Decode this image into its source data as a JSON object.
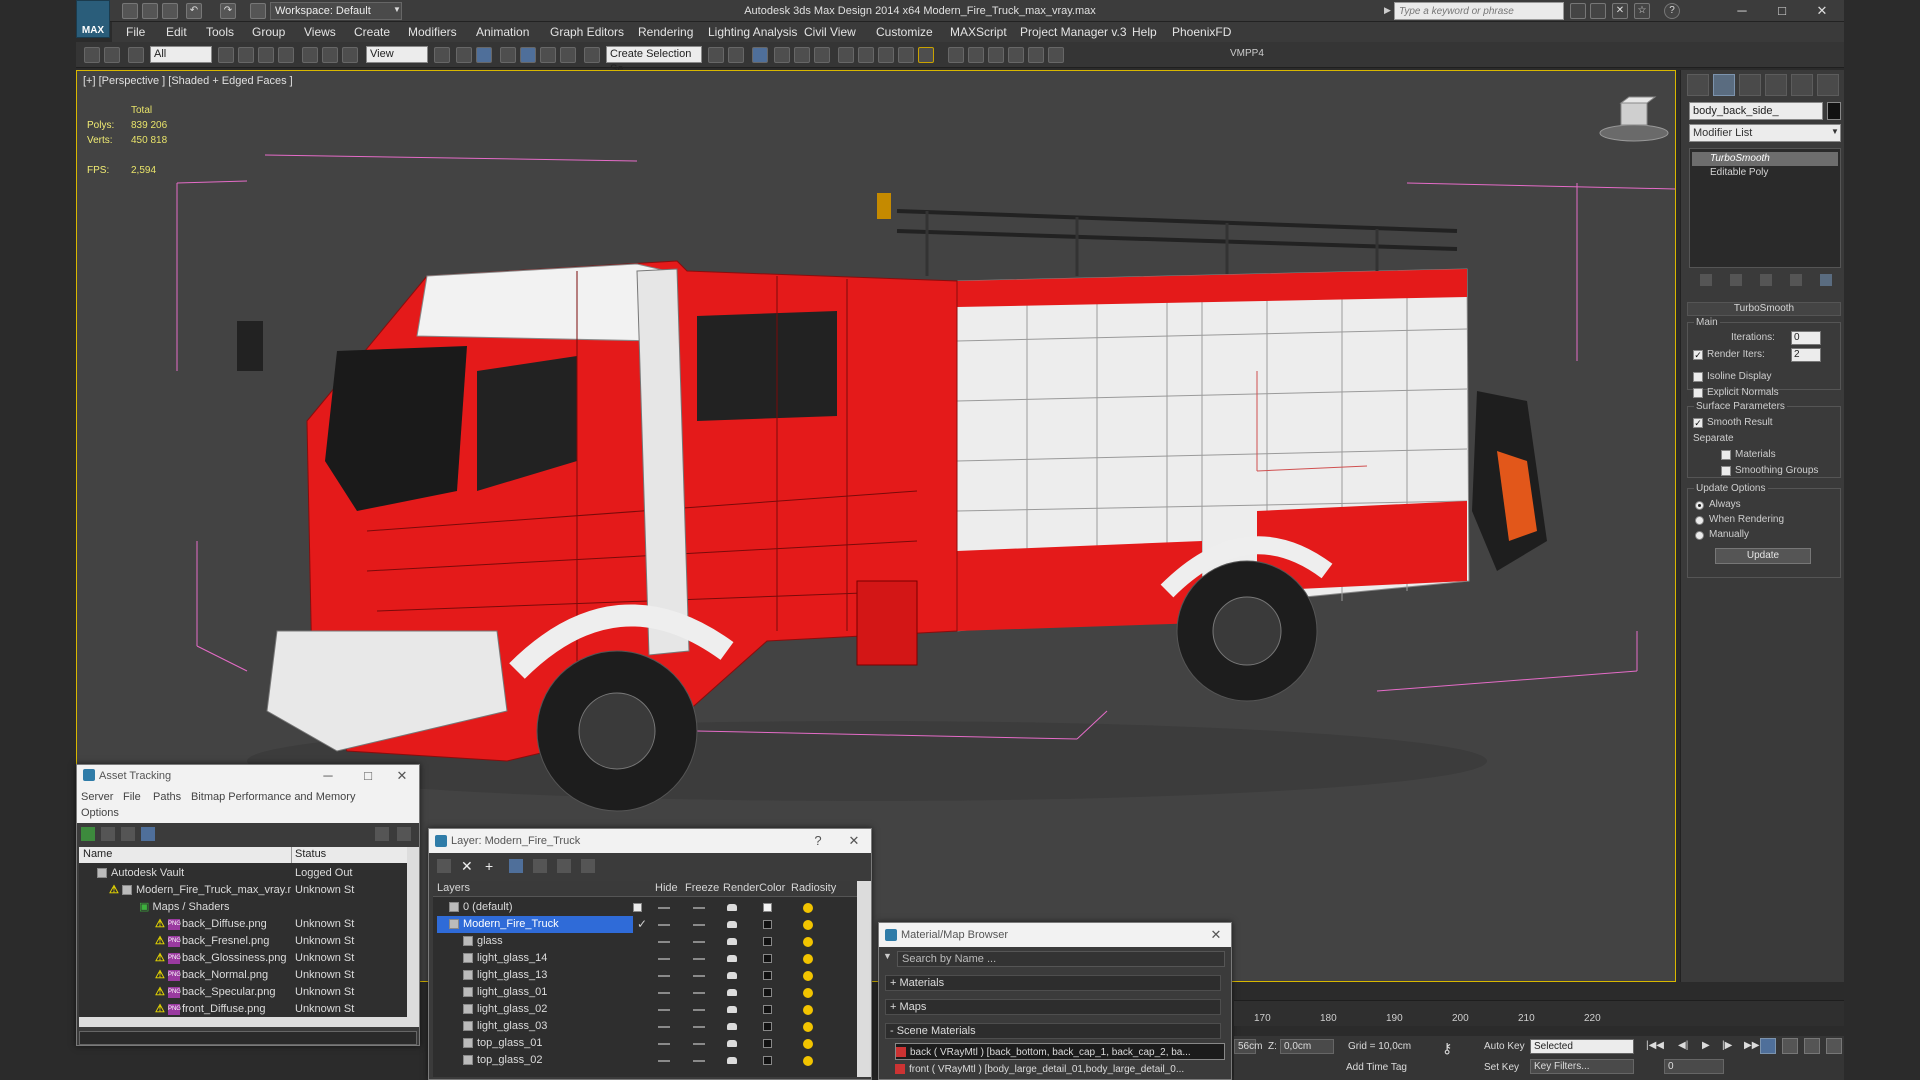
{
  "app": {
    "logo_text": "MAX",
    "workspace_label": "Workspace: Default",
    "window_title": "Autodesk 3ds Max Design 2014 x64     Modern_Fire_Truck_max_vray.max",
    "search_placeholder": "Type a keyword or phrase",
    "win_minimize": "─",
    "win_maximize": "□",
    "win_close": "✕"
  },
  "menu": [
    "File",
    "Edit",
    "Tools",
    "Group",
    "Views",
    "Create",
    "Modifiers",
    "Animation",
    "Graph Editors",
    "Rendering",
    "Lighting Analysis",
    "Civil View",
    "Customize",
    "MAXScript",
    "Project Manager v.3",
    "Help",
    "PhoenixFD"
  ],
  "toolbar": {
    "selection_filter": "All",
    "reference_coord": "View",
    "named_selection": "Create Selection Se",
    "plugin_label": "VMPP4"
  },
  "viewport": {
    "label": "[+] [Perspective ] [Shaded + Edged Faces ]",
    "stats_total_label": "Total",
    "polys_label": "Polys:",
    "polys_value": "839 206",
    "verts_label": "Verts:",
    "verts_value": "450 818",
    "fps_label": "FPS:",
    "fps_value": "2,594"
  },
  "command_panel": {
    "object_name": "body_back_side_",
    "modifier_list": "Modifier List",
    "stack": [
      "TurboSmooth",
      "Editable Poly"
    ],
    "rollout_title": "TurboSmooth",
    "main_group": "Main",
    "iterations_label": "Iterations:",
    "iterations_value": "0",
    "render_iters_label": "Render Iters:",
    "render_iters_value": "2",
    "render_iters_checked": "✓",
    "isoline_display": "Isoline Display",
    "explicit_normals": "Explicit Normals",
    "surface_params_group": "Surface Parameters",
    "smooth_result": "Smooth Result",
    "smooth_result_checked": "✓",
    "separate_label": "Separate",
    "materials": "Materials",
    "smoothing_groups": "Smoothing Groups",
    "update_options_group": "Update Options",
    "always": "Always",
    "when_rendering": "When Rendering",
    "manually": "Manually",
    "update_button": "Update"
  },
  "asset_tracking": {
    "title": "Asset Tracking",
    "menu": [
      "Server",
      "File",
      "Paths",
      "Bitmap Performance and Memory",
      "Options"
    ],
    "col_name": "Name",
    "col_status": "Status",
    "rows": [
      {
        "name": "Autodesk Vault",
        "status": "Logged Out"
      },
      {
        "name": "Modern_Fire_Truck_max_vray.max",
        "status": "Unknown St"
      },
      {
        "name": "Maps / Shaders",
        "status": ""
      },
      {
        "name": "back_Diffuse.png",
        "status": "Unknown St"
      },
      {
        "name": "back_Fresnel.png",
        "status": "Unknown St"
      },
      {
        "name": "back_Glossiness.png",
        "status": "Unknown St"
      },
      {
        "name": "back_Normal.png",
        "status": "Unknown St"
      },
      {
        "name": "back_Specular.png",
        "status": "Unknown St"
      },
      {
        "name": "front_Diffuse.png",
        "status": "Unknown St"
      }
    ],
    "png_badge": "PNG"
  },
  "layer_window": {
    "title": "Layer: Modern_Fire_Truck",
    "help": "?",
    "close": "✕",
    "col_layers": "Layers",
    "col_hide": "Hide",
    "col_freeze": "Freeze",
    "col_render": "Render",
    "col_color": "Color",
    "col_radiosity": "Radiosity",
    "rows": [
      "0 (default)",
      "Modern_Fire_Truck",
      "glass",
      "light_glass_14",
      "light_glass_13",
      "light_glass_01",
      "light_glass_02",
      "light_glass_03",
      "top_glass_01",
      "top_glass_02"
    ]
  },
  "material_browser": {
    "title": "Material/Map Browser",
    "search_placeholder": "Search by Name ...",
    "sections": [
      "+ Materials",
      "+ Maps",
      "- Scene Materials"
    ],
    "scene_items": [
      "back  ( VRayMtl ) [back_bottom, back_cap_1, back_cap_2, ba...",
      "front  ( VRayMtl ) [body_large_detail_01,body_large_detail_0..."
    ]
  },
  "timeline": {
    "ticks": [
      "170",
      "180",
      "190",
      "200",
      "210",
      "220"
    ]
  },
  "statusbar": {
    "x_value": "56cm",
    "z_label": "Z:",
    "z_value": "0,0cm",
    "grid_label": "Grid = 10,0cm",
    "auto_key": "Auto Key",
    "set_key": "Set Key",
    "selected": "Selected",
    "add_time_tag": "Add Time Tag",
    "key_filters": "Key Filters...",
    "frame_value": "0"
  },
  "colors": {
    "truck_red": "#e41a1a",
    "selection_yellow": "#d9b800",
    "layer_highlight": "#2f6bd8"
  }
}
